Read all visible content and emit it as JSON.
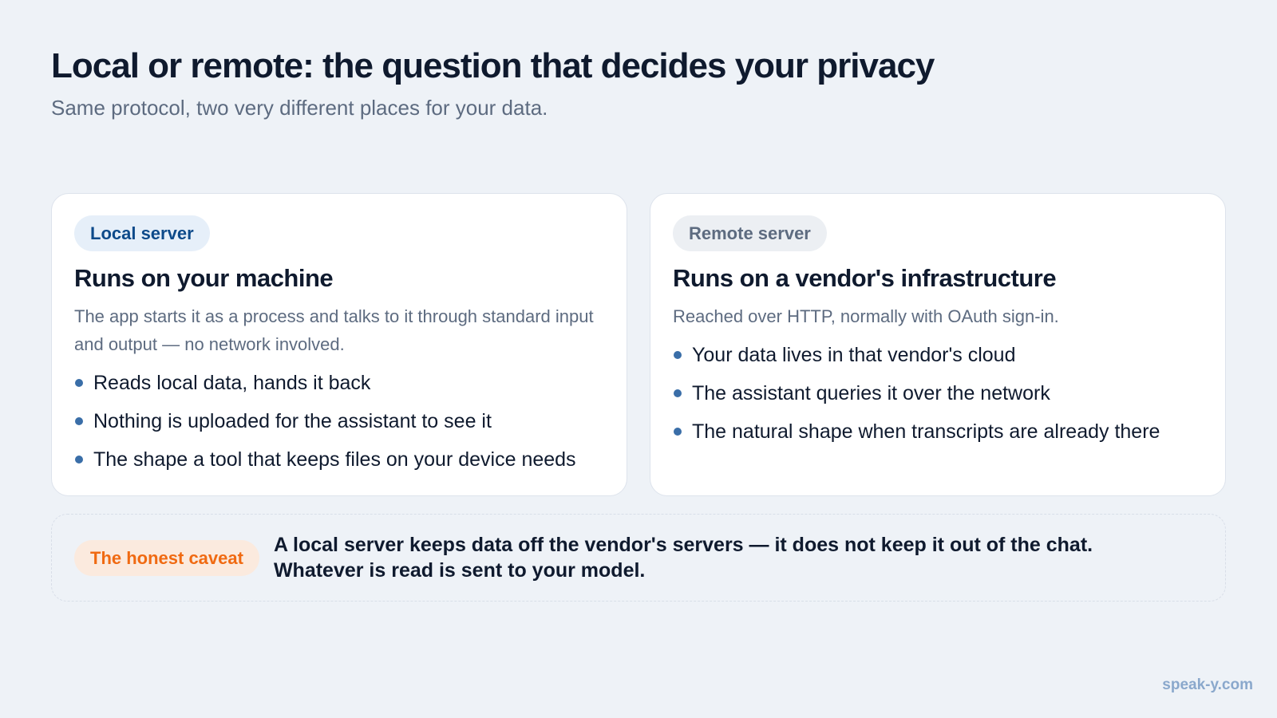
{
  "header": {
    "title": "Local or remote: the question that decides your privacy",
    "subtitle": "Same protocol, two very different places for your data."
  },
  "local": {
    "tag": "Local server",
    "heading": "Runs on your machine",
    "description": "The app starts it as a process and talks to it through standard input and output — no network involved.",
    "bullets": [
      "Reads local data, hands it back",
      "Nothing is uploaded for the assistant to see it",
      "The shape a tool that keeps files on your device needs"
    ]
  },
  "remote": {
    "tag": "Remote server",
    "heading": "Runs on a vendor's infrastructure",
    "description": "Reached over HTTP, normally with OAuth sign-in.",
    "bullets": [
      "Your data lives in that vendor's cloud",
      "The assistant queries it over the network",
      "The natural shape when transcripts are already there"
    ]
  },
  "caveat": {
    "tag": "The honest caveat",
    "line1": "A local server keeps data off the vendor's servers — it does not keep it out of the chat.",
    "line2": "Whatever is read is sent to your model."
  },
  "footer": {
    "brand": "speak-y.com"
  },
  "colors": {
    "background": "#eef2f7",
    "bullet": "#3a6ea8",
    "local_tag": "#0d4a8a",
    "caveat_tag": "#f06a12"
  }
}
